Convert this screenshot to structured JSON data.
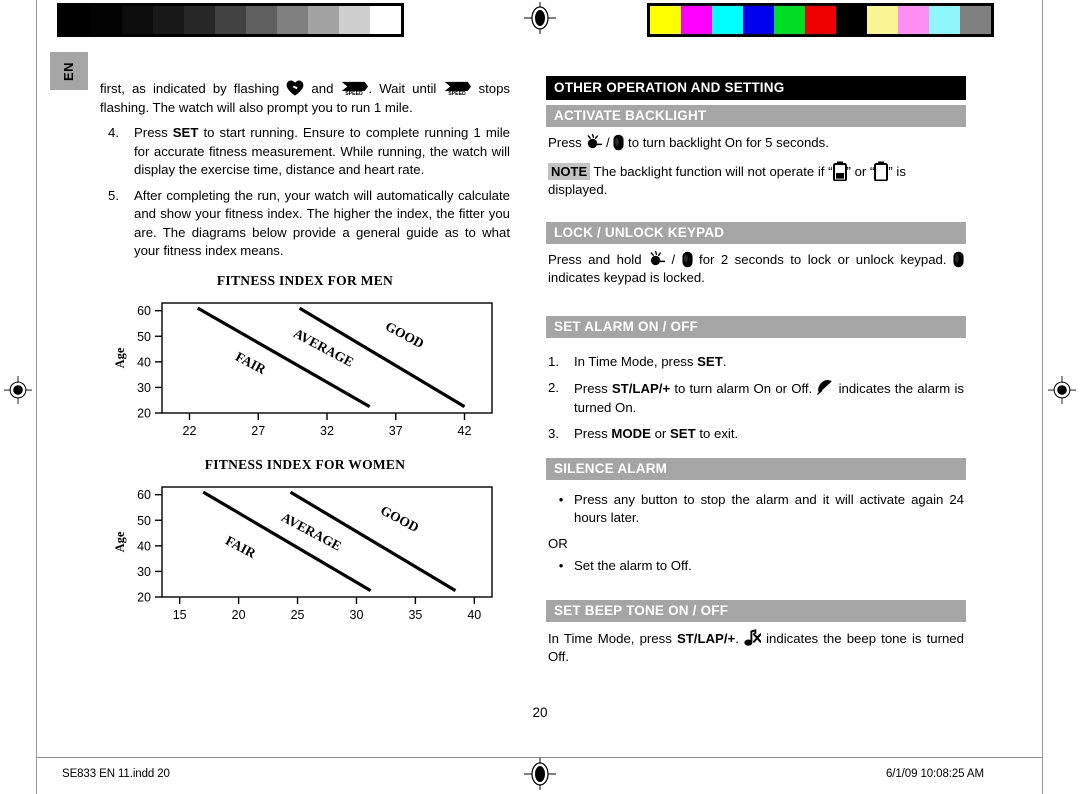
{
  "document": {
    "language_tab": "EN",
    "page_number": "20",
    "footer_left": "SE833 EN 11.indd   20",
    "footer_right": "6/1/09   10:08:25 AM"
  },
  "print_marks": {
    "grayscale_swatches": [
      "#000000",
      "#030303",
      "#0c0c0c",
      "#181818",
      "#272727",
      "#424242",
      "#606060",
      "#808080",
      "#a3a3a3",
      "#cfcfcf",
      "#ffffff"
    ],
    "color_swatches": [
      "#ffff00",
      "#ff00ff",
      "#00ffff",
      "#0000ee",
      "#00dd22",
      "#ee0000",
      "#000000",
      "#fcf594",
      "#ff8ef4",
      "#8ef5f9",
      "#808080"
    ]
  },
  "left_column": {
    "continued_paragraph": {
      "part1": "first, as indicated by flashing ",
      "part2": " and ",
      "part3": ". Wait until ",
      "part4": " stops flashing. The watch will also prompt you to run 1 mile."
    },
    "steps": [
      {
        "number": "4.",
        "text_pre": "Press ",
        "bold": "SET",
        "text_post": " to start running. Ensure to complete running 1 mile for accurate fitness measurement. While running, the watch will display the exercise time, distance and heart rate."
      },
      {
        "number": "5.",
        "text_pre": "",
        "bold": "",
        "text_post": "After completing the run, your watch will automatically calculate and show your fitness index. The higher the index, the fitter you are. The diagrams below provide a general guide as to what your fitness index means."
      }
    ]
  },
  "chart_data": [
    {
      "type": "line",
      "title": "FITNESS INDEX FOR MEN",
      "xlabel": "",
      "ylabel": "Age",
      "xlim": [
        20,
        44
      ],
      "ylim": [
        20,
        63
      ],
      "xticks": [
        22,
        27,
        32,
        37,
        42
      ],
      "yticks": [
        20,
        30,
        40,
        50,
        60
      ],
      "grid": false,
      "legend": "none",
      "annotations": [
        {
          "label": "FAIR",
          "x": 26.3,
          "y": 38
        },
        {
          "label": "AVERAGE",
          "x": 31.6,
          "y": 44
        },
        {
          "label": "GOOD",
          "x": 37.5,
          "y": 49
        }
      ],
      "series": [
        {
          "name": "fair-average boundary",
          "x": [
            22.6,
            35.1
          ],
          "y": [
            61,
            22.5
          ]
        },
        {
          "name": "average-good boundary",
          "x": [
            30.0,
            42.0
          ],
          "y": [
            61,
            22.5
          ]
        }
      ]
    },
    {
      "type": "line",
      "title": "FITNESS INDEX FOR WOMEN",
      "xlabel": "",
      "ylabel": "Age",
      "xlim": [
        13.5,
        41.5
      ],
      "ylim": [
        20,
        63
      ],
      "xticks": [
        15,
        20,
        25,
        30,
        35,
        40
      ],
      "yticks": [
        20,
        30,
        40,
        50,
        60
      ],
      "grid": false,
      "legend": "none",
      "annotations": [
        {
          "label": "FAIR",
          "x": 20.0,
          "y": 38
        },
        {
          "label": "AVERAGE",
          "x": 26.0,
          "y": 44
        },
        {
          "label": "GOOD",
          "x": 33.5,
          "y": 49
        }
      ],
      "series": [
        {
          "name": "fair-average boundary",
          "x": [
            17.0,
            31.2
          ],
          "y": [
            61,
            22.5
          ]
        },
        {
          "name": "average-good boundary",
          "x": [
            24.4,
            38.4
          ],
          "y": [
            61,
            22.5
          ]
        }
      ]
    }
  ],
  "right_column": {
    "main_header": "OTHER OPERATION AND SETTING",
    "sections": [
      {
        "header": "ACTIVATE BACKLIGHT",
        "line_pre": "Press ",
        "line_mid": " / ",
        "line_post": " to turn backlight On for 5 seconds.",
        "note_tag": "NOTE",
        "note_pre": " The backlight function will not operate if “",
        "note_mid": "” or “",
        "note_post": "” is displayed."
      },
      {
        "header": "LOCK / UNLOCK KEYPAD",
        "line_pre": "Press and hold ",
        "line_mid": " / ",
        "line_post": " for 2 seconds to lock or unlock keypad. ",
        "line_end": " indicates keypad is locked."
      },
      {
        "header": "SET ALARM ON / OFF",
        "steps": [
          {
            "number": "1.",
            "pre": "In Time Mode, press ",
            "bold": "SET",
            "post": "."
          },
          {
            "number": "2.",
            "pre": "Press ",
            "bold": "ST/LAP/+",
            "post": " to turn alarm On or Off. ",
            "post2": " indicates the alarm is turned On."
          },
          {
            "number": "3.",
            "pre": "Press ",
            "bold": "MODE",
            "mid": " or ",
            "bold2": "SET",
            "post": " to exit."
          }
        ]
      },
      {
        "header": "SILENCE ALARM",
        "bullets": [
          "Press any button to stop the alarm and it will activate again 24 hours later.",
          "Set the alarm to Off."
        ],
        "or_label": "OR"
      },
      {
        "header": "SET BEEP TONE ON / OFF",
        "line_pre": "In Time Mode, press ",
        "bold": "ST/LAP/+",
        "line_mid": ". ",
        "line_post": " indicates the beep tone is turned Off."
      }
    ]
  },
  "icons": {
    "heart": "heart-icon",
    "speed": "speed-icon",
    "backlight": "backlight-icon",
    "key": "key-icon",
    "battery_low": "battery-low-icon",
    "battery_empty": "battery-empty-icon",
    "bell": "bell-icon",
    "mute": "beep-off-icon"
  }
}
